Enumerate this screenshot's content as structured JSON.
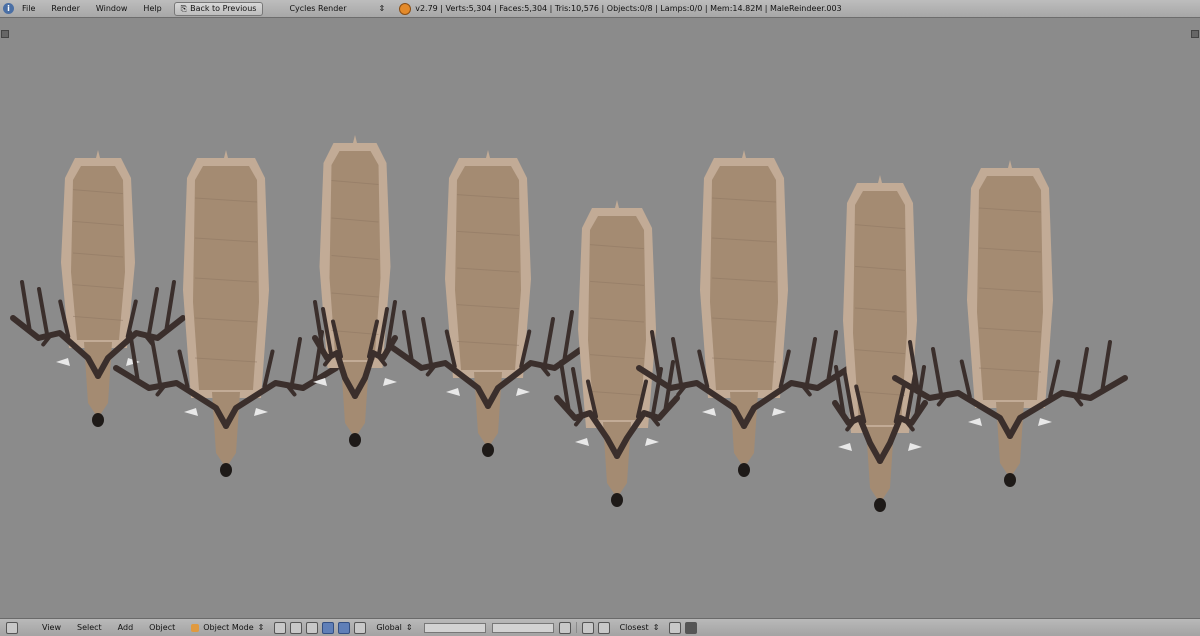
{
  "top_menu": {
    "items": [
      "File",
      "Render",
      "Window",
      "Help"
    ],
    "back_button": "Back to Previous",
    "render_engine": "Cycles Render",
    "stats": "v2.79 | Verts:5,304 | Faces:5,304 | Tris:10,576 | Objects:0/8 | Lamps:0/0 | Mem:14.82M | MaleReindeer.003"
  },
  "bottom_bar": {
    "menus": [
      "View",
      "Select",
      "Add",
      "Object"
    ],
    "mode": "Object Mode",
    "orientation": "Global",
    "snap": "Closest"
  },
  "viewport": {
    "reindeer_count": 8,
    "colors": {
      "background": "#8b8b8b",
      "body": "#a48b72",
      "body_light": "#c2ab96",
      "antler": "#3b2f2c",
      "hoof": "#1e1a18",
      "white": "#e8e8e8"
    }
  }
}
